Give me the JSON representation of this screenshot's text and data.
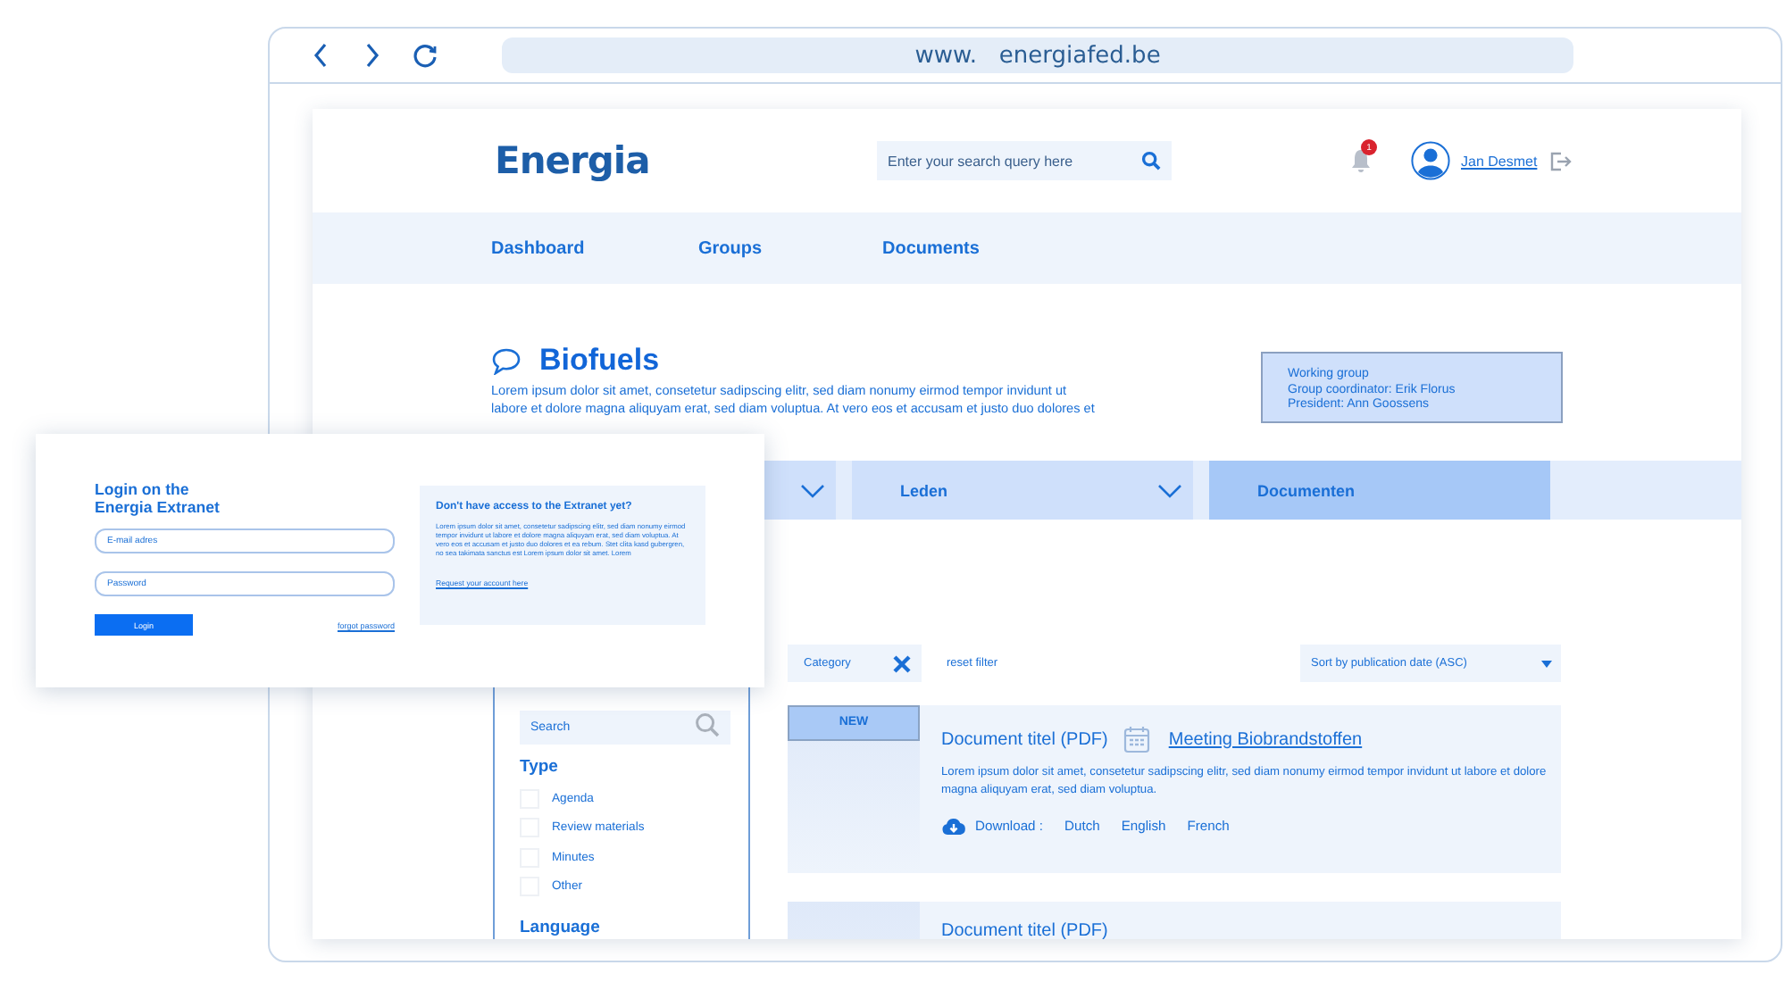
{
  "browser": {
    "url": "www.   energiafed.be"
  },
  "header": {
    "logo": "Energia",
    "search": {
      "placeholder": "Enter your search query here"
    },
    "notifications": "1",
    "user": "Jan Desmet"
  },
  "nav": [
    {
      "label": "Dashboard"
    },
    {
      "label": "Groups"
    },
    {
      "label": "Documents"
    }
  ],
  "group": {
    "title": "Biofuels",
    "description": "Lorem ipsum dolor sit amet, consetetur sadipscing elitr, sed diam nonumy eirmod tempor invidunt ut labore et dolore magna aliquyam erat, sed diam voluptua. At vero eos et accusam et justo duo dolores et",
    "info": [
      "Working group",
      "Group coordinator: Erik Florus",
      "President: Ann Goossens"
    ]
  },
  "tabs": [
    {
      "dropdown": true,
      "selected": false
    },
    {
      "label": "Leden",
      "dropdown": true,
      "selected": false
    },
    {
      "label": "Documenten",
      "dropdown": false,
      "selected": true
    }
  ],
  "filters": {
    "search": {
      "placeholder": "Search"
    },
    "type_heading": "Type",
    "types": [
      {
        "label": "Agenda",
        "checked": false
      },
      {
        "label": "Review materials",
        "checked": false
      },
      {
        "label": "Minutes",
        "checked": false
      },
      {
        "label": "Other",
        "checked": false
      }
    ],
    "language_heading": "Language"
  },
  "toolbar": {
    "chip": "Category",
    "reset": "reset filter",
    "sort": "Sort by publication date (ASC)"
  },
  "documents": [
    {
      "badge": "NEW",
      "title": "Document titel (PDF)",
      "meeting": "Meeting Biobrandstoffen",
      "description": "Lorem ipsum dolor sit amet, consetetur sadipscing elitr, sed diam nonumy eirmod tempor invidunt ut labore et dolore magna aliquyam erat, sed diam voluptua.",
      "download_label": "Download :",
      "languages": [
        "Dutch",
        "English",
        "French"
      ]
    },
    {
      "title": "Document titel (PDF)"
    }
  ],
  "login": {
    "title": "Login on the\nEnergia Extranet",
    "email": {
      "placeholder": "E-mail adres"
    },
    "password": {
      "placeholder": "Password"
    },
    "button": "Login",
    "forgot": "forgot password",
    "aside_title": "Don't have access to the Extranet yet?",
    "aside_text": "Lorem ipsum dolor sit amet, consetetur sadipscing elitr, sed diam nonumy eirmod tempor invidunt ut labore et dolore magna aliquyam erat, sed diam voluptua. At vero eos et accusam et justo duo dolores et ea rebum. Stet clita kasd gubergren, no sea takimata sanctus est Lorem ipsum dolor sit amet. Lorem",
    "request": "Request your account here"
  }
}
